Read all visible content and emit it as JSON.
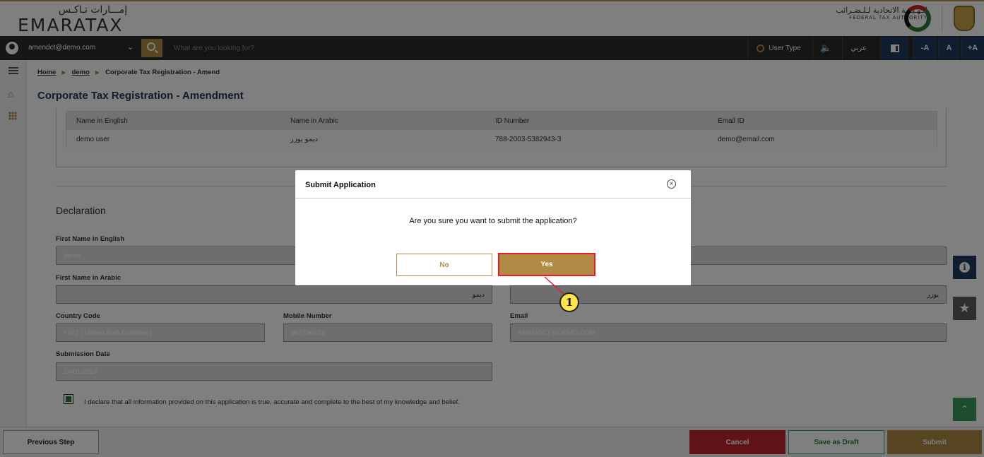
{
  "header": {
    "logo_arabic": "إمـــارات تـاكـس",
    "logo_english": "EMARATAX",
    "fta_arabic": "الـهـيـئـة الاتحادية لـلـضـرائب",
    "fta_english": "FEDERAL TAX AUTHORITY"
  },
  "toolbar": {
    "user_email": "amendct@demo.com",
    "search_placeholder": "What are you looking for?",
    "user_type_label": "User Type",
    "speaker_icon": "speaker-icon",
    "arabic_label": "عربي",
    "font_decrease": "-A",
    "font_normal": "A",
    "font_increase": "+A"
  },
  "breadcrumb": {
    "home": "Home",
    "demo": "demo",
    "current": "Corporate Tax Registration - Amend"
  },
  "page_title": "Corporate Tax Registration - Amendment",
  "contact_table": {
    "headers": [
      "Name in English",
      "Name in Arabic",
      "ID Number",
      "Email ID"
    ],
    "row": [
      "demo user",
      "ديمو يوزر",
      "788-2003-5382943-3",
      "demo@email.com"
    ]
  },
  "declaration": {
    "title": "Declaration",
    "first_name_en_label": "First Name in English",
    "first_name_en_value": "demo",
    "first_name_ar_label": "First Name in Arabic",
    "first_name_ar_value": "ديمو",
    "last_name_ar_value": "يوزر",
    "country_code_label": "Country Code",
    "country_code_value": "+971 ( United Arab Emirates )",
    "mobile_label": "Mobile Number",
    "mobile_value": "962796123",
    "email_label": "Email",
    "email_value": "AMENDCT@DEMO.COM",
    "submission_date_label": "Submission Date",
    "submission_date_value": "24/01/2024",
    "checkbox_checked": true,
    "declaration_text": "I declare that all information provided on this application is true, accurate and complete to the best of my knowledge and belief."
  },
  "bottom_bar": {
    "previous": "Previous Step",
    "cancel": "Cancel",
    "save_draft": "Save as Draft",
    "submit": "Submit"
  },
  "modal": {
    "title": "Submit Application",
    "message": "Are you sure you want to submit the application?",
    "no": "No",
    "yes": "Yes"
  },
  "callout": {
    "number": "1"
  },
  "colors": {
    "gold": "#b18a45",
    "navy": "#1e3a5f",
    "red": "#c1272d",
    "green": "#3a9b5c"
  }
}
